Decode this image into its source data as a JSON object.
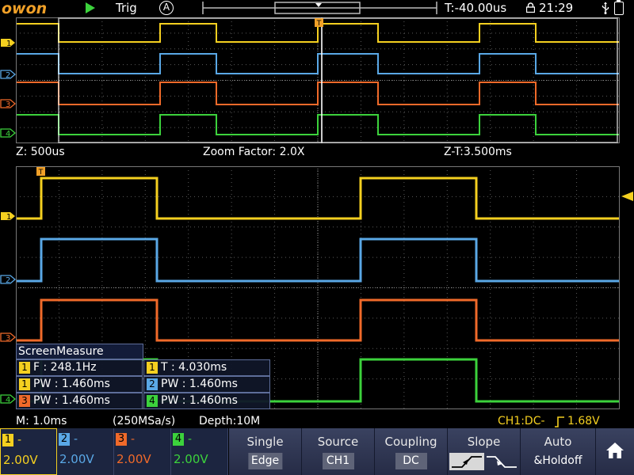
{
  "top": {
    "logo": "owon",
    "trigger_label": "Trig",
    "auto_label": "A",
    "time_offset": "T:-40.00us",
    "clock": "21:29"
  },
  "zoom_info": {
    "zoom_timebase": "Z: 500us",
    "zoom_factor": "Zoom Factor: 2.0X",
    "zoom_trigger_time": "Z-T:3.500ms"
  },
  "measure": {
    "title": "ScreenMeasure",
    "rows": [
      {
        "ch": "1",
        "text": "F : 248.1Hz",
        "color": "#f5d020"
      },
      {
        "ch": "1",
        "text": "T : 4.030ms",
        "color": "#f5d020"
      },
      {
        "ch": "1",
        "text": "PW : 1.460ms",
        "color": "#f5d020"
      },
      {
        "ch": "2",
        "text": "PW : 1.460ms",
        "color": "#5aa8e6"
      },
      {
        "ch": "3",
        "text": "PW : 1.460ms",
        "color": "#f06a2a"
      },
      {
        "ch": "4",
        "text": "PW : 1.460ms",
        "color": "#3cd23c"
      }
    ]
  },
  "info": {
    "main_timebase": "M: 1.0ms",
    "sample_rate": "(250MSa/s)",
    "depth": "Depth:10M",
    "trigger_info": "CH1:DC-",
    "trigger_level": "1.68V"
  },
  "channels": [
    {
      "num": "1",
      "dash": "-",
      "volts": "2.00V",
      "color": "#f5d020"
    },
    {
      "num": "2",
      "dash": "-",
      "volts": "2.00V",
      "color": "#5aa8e6"
    },
    {
      "num": "3",
      "dash": "-",
      "volts": "2.00V",
      "color": "#f06a2a"
    },
    {
      "num": "4",
      "dash": "-",
      "volts": "2.00V",
      "color": "#3cd23c"
    }
  ],
  "menu": {
    "single": {
      "title": "Single",
      "value": "Edge"
    },
    "source": {
      "title": "Source",
      "value": "CH1"
    },
    "coupling": {
      "title": "Coupling",
      "value": "DC"
    },
    "slope": {
      "title": "Slope"
    },
    "auto": {
      "title": "Auto",
      "value": "&Holdoff"
    }
  },
  "colors": {
    "ch1": "#f5d020",
    "ch2": "#5aa8e6",
    "ch3": "#f06a2a",
    "ch4": "#3cd23c",
    "logo": "#f0a028",
    "grid": "#5a5a5a"
  },
  "marker_labels": {
    "trigger": "T"
  }
}
